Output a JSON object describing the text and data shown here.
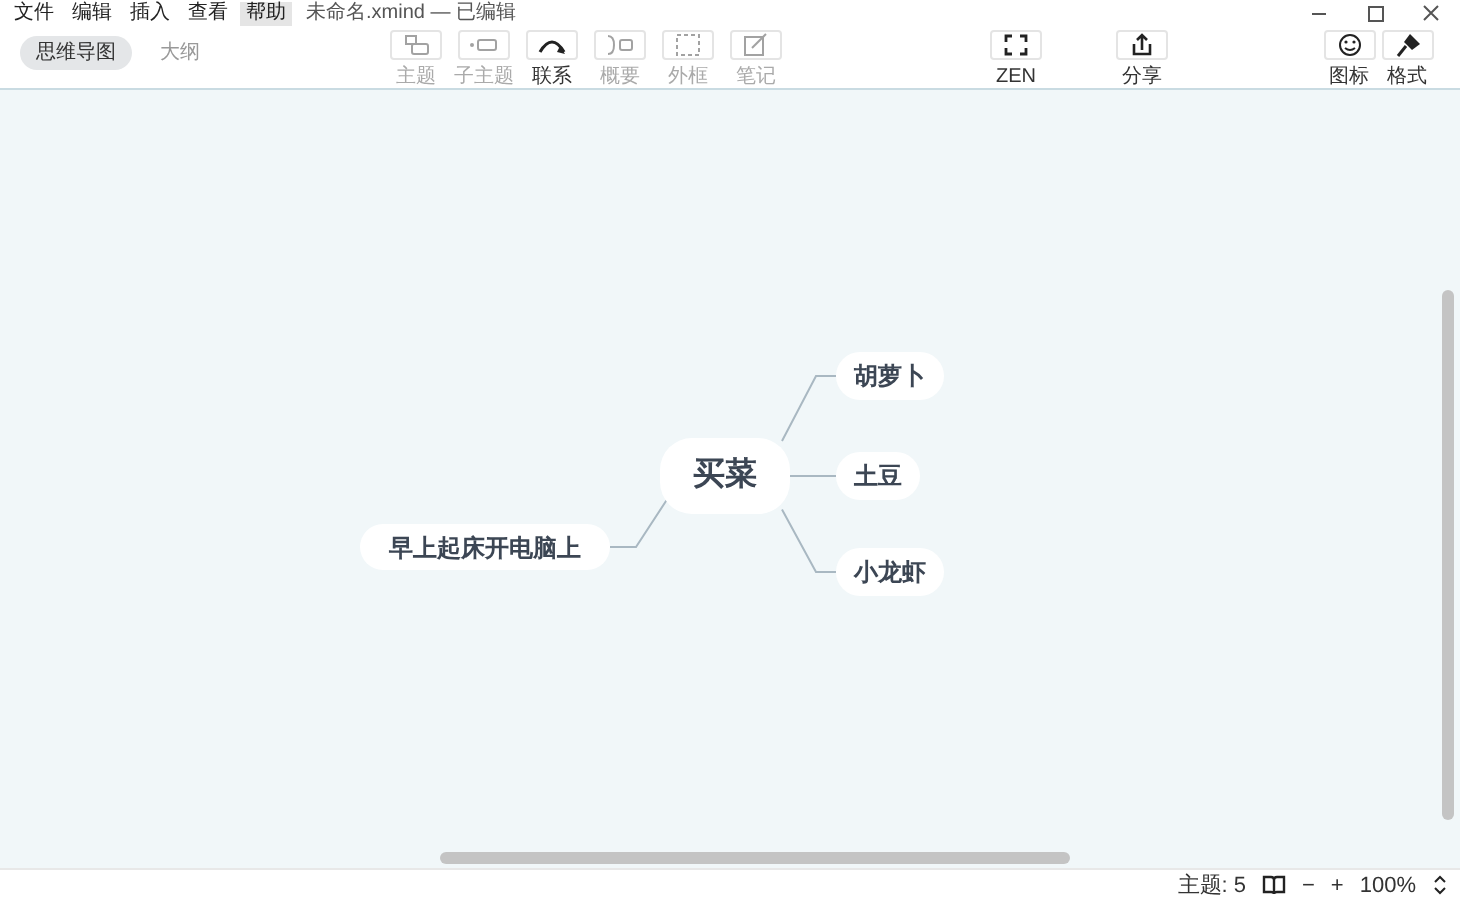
{
  "menu": [
    {
      "label": "文件",
      "selected": false
    },
    {
      "label": "编辑",
      "selected": false
    },
    {
      "label": "插入",
      "selected": false
    },
    {
      "label": "查看",
      "selected": false
    },
    {
      "label": "帮助",
      "selected": true
    }
  ],
  "window": {
    "title": "未命名.xmind — 已编辑"
  },
  "view_tabs": [
    {
      "label": "思维导图",
      "selected": true
    },
    {
      "label": "大纲",
      "selected": false
    }
  ],
  "toolbar": [
    {
      "label": "主题",
      "kind": "topic",
      "disabled": true
    },
    {
      "label": "子主题",
      "kind": "subtopic",
      "disabled": true
    },
    {
      "label": "联系",
      "kind": "relation",
      "disabled": false
    },
    {
      "label": "概要",
      "kind": "summary",
      "disabled": true
    },
    {
      "label": "外框",
      "kind": "boundary",
      "disabled": true
    },
    {
      "label": "笔记",
      "kind": "note",
      "disabled": true
    }
  ],
  "zen_button": {
    "label": "ZEN"
  },
  "share_button": {
    "label": "分享"
  },
  "panel_buttons": [
    {
      "label": "图标",
      "kind": "icon"
    },
    {
      "label": "格式",
      "kind": "format"
    }
  ],
  "mind_map": {
    "root": {
      "label": "买菜",
      "children": [
        {
          "label": "胡萝卜"
        },
        {
          "label": "土豆"
        },
        {
          "label": "小龙虾"
        },
        {
          "label": "早上起床开电脑上"
        }
      ]
    }
  },
  "status_bar": {
    "topic_count": "主题: 5",
    "zoom_out": "−",
    "zoom_in": "+",
    "zoom": "100%"
  }
}
